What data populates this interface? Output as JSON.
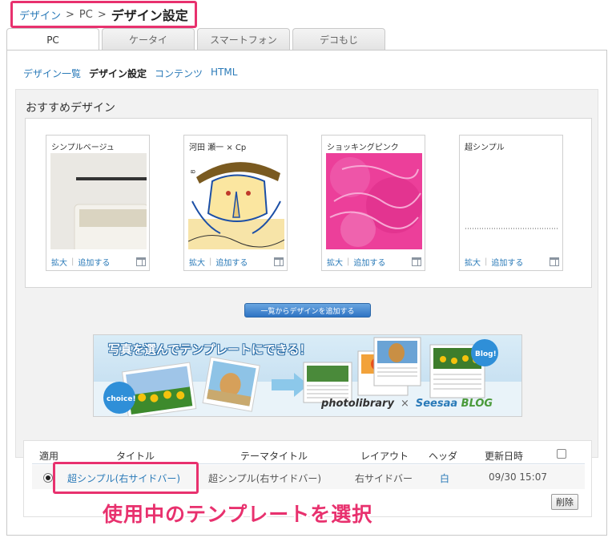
{
  "breadcrumb": {
    "items": [
      "デザイン",
      "PC"
    ],
    "separator": ">",
    "current": "デザイン設定"
  },
  "tabs": [
    {
      "label": "PC",
      "active": true
    },
    {
      "label": "ケータイ",
      "active": false
    },
    {
      "label": "スマートフォン",
      "active": false
    },
    {
      "label": "デコもじ",
      "active": false
    }
  ],
  "subnav": {
    "items": [
      "デザイン一覧",
      "デザイン設定",
      "コンテンツ",
      "HTML"
    ],
    "current": "デザイン設定"
  },
  "recommend": {
    "title": "おすすめデザイン",
    "cards": [
      {
        "title": "シンプルベージュ",
        "zoom_label": "拡大",
        "add_label": "追加する",
        "icon": "layout-icon"
      },
      {
        "title": "河田 瀬一 × Cp",
        "zoom_label": "拡大",
        "add_label": "追加する",
        "icon": "layout-icon"
      },
      {
        "title": "ショッキングピンク",
        "zoom_label": "拡大",
        "add_label": "追加する",
        "icon": "layout-icon"
      },
      {
        "title": "超シンプル",
        "zoom_label": "拡大",
        "add_label": "追加する",
        "icon": "layout-icon"
      }
    ],
    "add_from_list_button": "一覧からデザインを追加する"
  },
  "banner": {
    "title": "写真を選んでテンプレートにできる！",
    "badge_left": "choice!",
    "badge_right": "Blog!",
    "brand": "photolibrary",
    "times": "×",
    "partner": "Seesaa",
    "partner_suffix": "BLOG"
  },
  "template_table": {
    "headers": {
      "apply": "適用",
      "title": "タイトル",
      "theme_title": "テーマタイトル",
      "layout": "レイアウト",
      "header": "ヘッダ",
      "updated": "更新日時"
    },
    "rows": [
      {
        "selected": true,
        "title": "超シンプル(右サイドバー)",
        "theme_title": "超シンプル(右サイドバー)",
        "layout": "右サイドバー",
        "header": "白",
        "updated": "09/30 15:07"
      }
    ],
    "delete_button": "削除"
  },
  "annotation": {
    "text": "使用中のテンプレートを選択"
  },
  "colors": {
    "highlight": "#e8316e",
    "link": "#2a7ab8",
    "button_blue": "#2f74c4"
  }
}
